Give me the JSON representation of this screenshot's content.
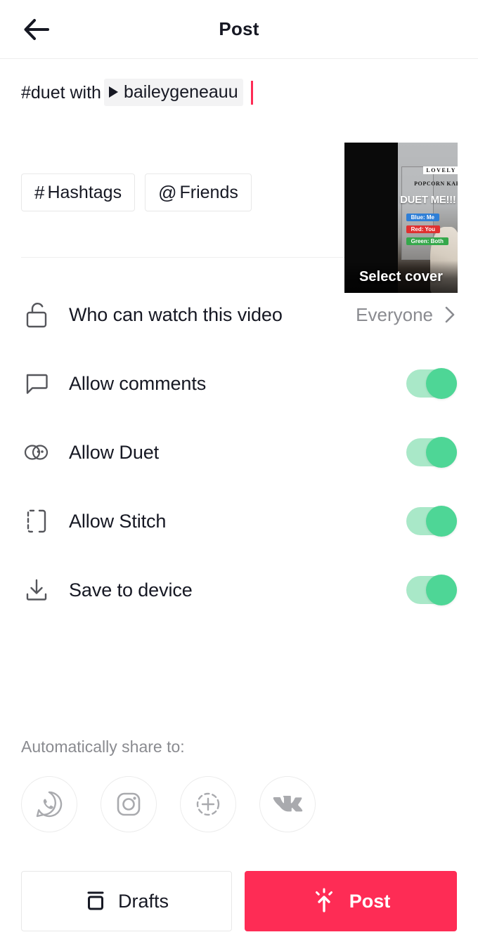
{
  "header": {
    "title": "Post",
    "back_icon": "arrow-left-icon"
  },
  "caption": {
    "prefix_text": "#duet with",
    "mention": "baileygeneauu",
    "mention_icon": "play-triangle-icon",
    "cursor_color": "#fe2c55"
  },
  "tag_buttons": [
    {
      "symbol": "#",
      "label": "Hashtags",
      "name": "hashtags-button"
    },
    {
      "symbol": "@",
      "label": "Friends",
      "name": "friends-button"
    }
  ],
  "cover": {
    "select_cover_label": "Select cover",
    "overlay_texts": {
      "brand_top": "LOVELY",
      "brand_sub": "POPCORN KAR",
      "headline": "DUET ME!!!",
      "tag_blue": "Blue: Me",
      "tag_red": "Red: You",
      "tag_green": "Green: Both"
    }
  },
  "settings": [
    {
      "icon": "unlock-icon",
      "label": "Who can watch this video",
      "control": "value",
      "value": "Everyone",
      "chevron_icon": "chevron-right-icon",
      "name": "who-can-watch-row"
    },
    {
      "icon": "comment-bubble-icon",
      "label": "Allow comments",
      "control": "toggle",
      "value": "on",
      "name": "allow-comments-row"
    },
    {
      "icon": "duet-icon",
      "label": "Allow Duet",
      "control": "toggle",
      "value": "on",
      "name": "allow-duet-row"
    },
    {
      "icon": "stitch-icon",
      "label": "Allow Stitch",
      "control": "toggle",
      "value": "on",
      "name": "allow-stitch-row"
    },
    {
      "icon": "download-icon",
      "label": "Save to device",
      "control": "toggle",
      "value": "on",
      "name": "save-to-device-row"
    }
  ],
  "auto_share": {
    "label": "Automatically share to:",
    "targets": [
      {
        "icon": "whatsapp-icon",
        "name": "share-whatsapp-button"
      },
      {
        "icon": "instagram-icon",
        "name": "share-instagram-button"
      },
      {
        "icon": "instagram-story-icon",
        "name": "share-instagram-story-button"
      },
      {
        "icon": "vk-icon",
        "name": "share-vk-button"
      }
    ]
  },
  "footer": {
    "drafts_label": "Drafts",
    "drafts_icon": "drafts-box-icon",
    "post_label": "Post",
    "post_icon": "upload-burst-icon"
  },
  "colors": {
    "accent_red": "#fe2c55",
    "toggle_knob_green": "#4ed696",
    "toggle_track_green": "#a9e8c8",
    "text_primary": "#161823",
    "text_muted": "#8a8b90"
  }
}
